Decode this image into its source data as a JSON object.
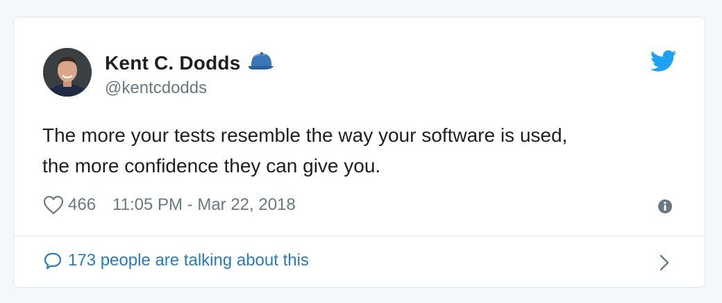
{
  "author": {
    "name": "Kent C. Dodds",
    "handle": "@kentcdodds",
    "avatar_icon": "person-photo",
    "badge_icon": "baseball-cap-icon"
  },
  "tweet": {
    "text_line1": "The more your tests resemble the way your software is used,",
    "text_line2": "the more confidence they can give you."
  },
  "meta": {
    "like_count": "466",
    "timestamp": "11:05 PM - Mar 22, 2018"
  },
  "conversation": {
    "label": "173 people are talking about this"
  },
  "colors": {
    "brand_blue": "#1da1f2",
    "link_blue": "#2b7bb9",
    "muted_gray": "#697882",
    "text_dark": "#1c2022",
    "border": "#e1e8ed"
  }
}
